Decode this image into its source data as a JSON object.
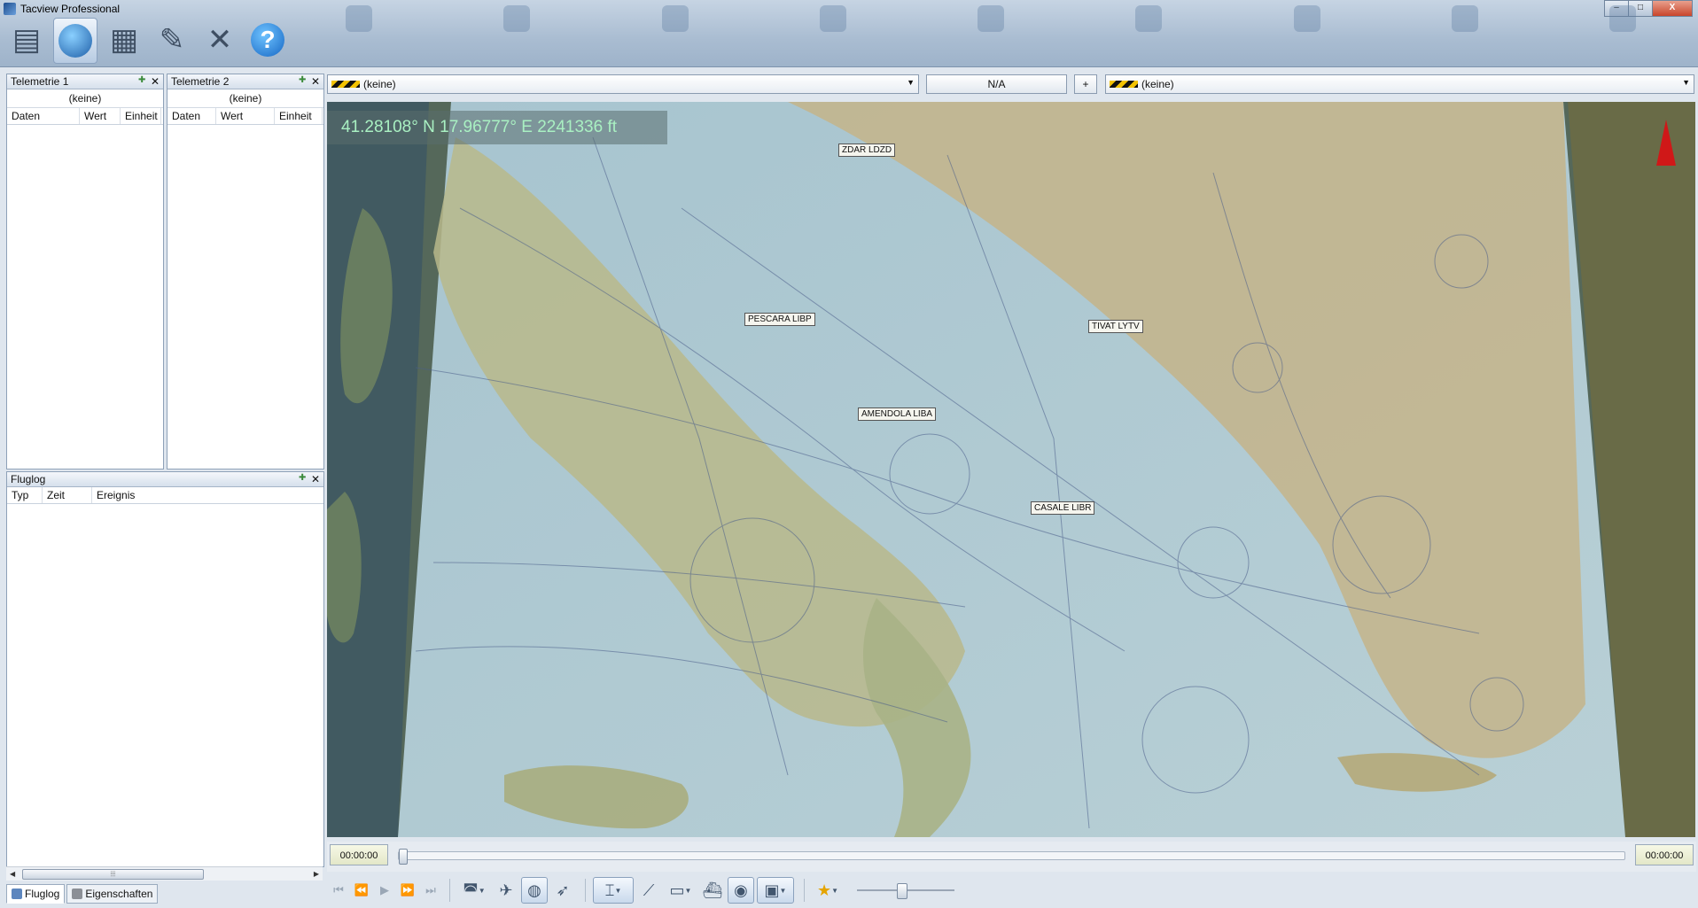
{
  "window": {
    "title": "Tacview Professional",
    "min": "–",
    "max": "□",
    "close": "X"
  },
  "toolbar": {
    "icons": [
      "server-icon",
      "globe-icon",
      "document-icon",
      "notepad-icon",
      "tools-icon",
      "help-icon"
    ],
    "help_glyph": "?"
  },
  "telemetry1": {
    "title": "Telemetrie 1",
    "selection": "(keine)",
    "cols": [
      "Daten",
      "Wert",
      "Einheit"
    ]
  },
  "telemetry2": {
    "title": "Telemetrie 2",
    "selection": "(keine)",
    "cols": [
      "Daten",
      "Wert",
      "Einheit"
    ]
  },
  "flightlog": {
    "title": "Fluglog",
    "cols": [
      "Typ",
      "Zeit",
      "Ereignis"
    ]
  },
  "bottom_tabs": {
    "fluglog": "Fluglog",
    "eigenschaften": "Eigenschaften"
  },
  "selectors": {
    "left": "(keine)",
    "middle": "N/A",
    "plus": "+",
    "right": "(keine)"
  },
  "map": {
    "coordinate": "41.28108° N  17.96777° E  2241336 ft",
    "airports": [
      {
        "label": "ZDAR LDZD"
      },
      {
        "label": "PESCARA LIBP"
      },
      {
        "label": "TIVAT LYTV"
      },
      {
        "label": "AMENDOLA LIBA"
      },
      {
        "label": "CASALE LIBR"
      }
    ]
  },
  "timeline": {
    "start": "00:00:00",
    "end": "00:00:00",
    "position": 0
  },
  "playback": {
    "first": "⏮",
    "prev": "⏪",
    "play": "▶",
    "next": "⏩",
    "last": "⏭"
  },
  "colors": {
    "coord_text": "#a9f0c2",
    "north_arrow": "#d01818",
    "hazard_yellow": "#f2c200"
  }
}
